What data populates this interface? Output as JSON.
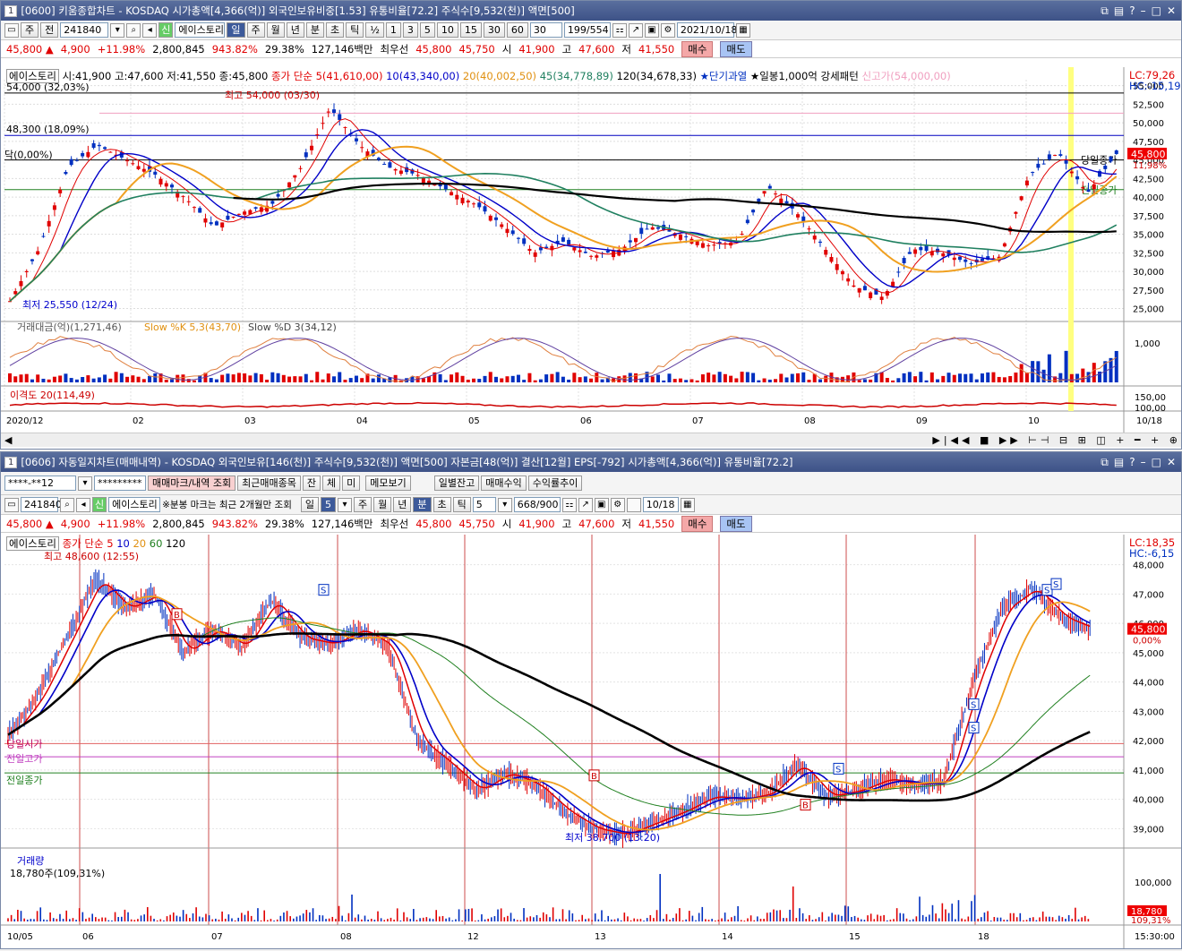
{
  "top": {
    "title": "[0600] 키움종합차트 - KOSDAQ 시가총액[4,366(억)] 외국인보유비중[1.53] 유통비율[72.2] 주식수[9,532(천)] 액면[500]",
    "window_num": "1",
    "toolbar": {
      "period": "주",
      "adj": "전",
      "code": "241840",
      "name": "에이스토리",
      "sel_badge": "신",
      "tabs": [
        "일",
        "주",
        "월",
        "년",
        "분",
        "초",
        "틱"
      ],
      "frac": "½",
      "nums": [
        "1",
        "3",
        "5",
        "10",
        "15",
        "30",
        "60"
      ],
      "n30": "30",
      "count": "199/554",
      "date": "2021/10/18"
    },
    "quote": {
      "price": "45,800 ▲",
      "change": "4,900",
      "pct": "+11.98%",
      "volume": "2,800,845",
      "vol_pct": "943.82%",
      "turnover": "29.38%",
      "amount": "127,146백만",
      "best_label": "최우선",
      "best_ask": "45,800",
      "best_bid": "45,750",
      "open_label": "시",
      "open": "41,900",
      "high_label": "고",
      "high": "47,600",
      "low_label": "저",
      "low": "41,550",
      "buy": "매수",
      "sell": "매도"
    },
    "legend": {
      "name": "에이스토리",
      "ohlc": "시:41,900 고:47,600 저:41,550 종:45,800",
      "ma_label": "종가 단순",
      "ma5": "5(41,610,00)",
      "ma10": "10(43,340,00)",
      "ma20": "20(40,002,50)",
      "ma45": "45(34,778,89)",
      "ma120": "120(34,678,33)",
      "pattern1": "★단기과열",
      "pattern2": "★일봉1,000억 강세패턴",
      "newhigh": "신고가(54,000,00)",
      "lc": "LC:79,26",
      "hc": "HC:-15,19"
    },
    "labels": {
      "level1": "54,000 (32,03%)",
      "level2": "48,300 (18,09%)",
      "level3": "닥(0,00%)",
      "max": "최고 54,000 (03/30)",
      "min": "최저 25,550 (12/24)",
      "today_close": "당일종가",
      "prev_close": "전일종가",
      "last_price": "45,800",
      "last_pct": "11,98%"
    },
    "price_axis": [
      "55,000",
      "52,500",
      "50,000",
      "47,500",
      "45,000",
      "42,500",
      "40,000",
      "37,500",
      "35,000",
      "32,500",
      "30,000",
      "27,500",
      "25,000"
    ],
    "osc": {
      "label1": "거래대금(억)(1,271,46)",
      "label2": "Slow %K 5,3(43,70)",
      "label3": "Slow %D 3(34,12)",
      "axis": "1,000"
    },
    "disp": {
      "label": "이격도 20(114,49)",
      "axis1": "150,00",
      "axis2": "100,00"
    },
    "date_axis": [
      "2020/12",
      "02",
      "03",
      "04",
      "05",
      "06",
      "07",
      "08",
      "09",
      "10"
    ],
    "date_right": "10/18"
  },
  "bottom": {
    "title": "[0606] 자동일지차트(매매내역) - KOSDAQ 외국인보유[146(천)] 주식수[9,532(천)] 액면[500] 자본금[48(억)] 결산[12월] EPS[-792] 시가총액[4,366(억)] 유통비율[72.2]",
    "window_num": "1",
    "toolbar1": {
      "account": "****-**12",
      "password": "*********",
      "b1": "매매마크/내역 조회",
      "b2": "최근매매종목",
      "b3": "잔",
      "b4": "체",
      "b5": "미",
      "b6": "메모보기",
      "b7": "일별잔고",
      "b8": "매매수익",
      "b9": "수익률추이"
    },
    "toolbar2": {
      "code": "241840",
      "sel_badge": "신",
      "name": "에이스토리",
      "note": "※분봉 마크는 최근 2개월만 조회",
      "t_day": "일",
      "n5": "5",
      "tabs": [
        "주",
        "월",
        "년",
        "분",
        "초",
        "틱"
      ],
      "n5b": "5",
      "count": "668/900",
      "date": "10/18"
    },
    "quote": {
      "price": "45,800 ▲",
      "change": "4,900",
      "pct": "+11.98%",
      "volume": "2,800,845",
      "vol_pct": "943.82%",
      "turnover": "29.38%",
      "amount": "127,146백만",
      "best_label": "최우선",
      "best_ask": "45,800",
      "best_bid": "45,750",
      "open_label": "시",
      "open": "41,900",
      "high_label": "고",
      "high": "47,600",
      "low_label": "저",
      "low": "41,550",
      "buy": "매수",
      "sell": "매도"
    },
    "legend": {
      "name": "에이스토리",
      "ma_label": "종가 단순",
      "ma5": "5",
      "ma10": "10",
      "ma20": "20",
      "ma60": "60",
      "ma120": "120",
      "lc": "LC:18,35",
      "hc": "HC:-6,15"
    },
    "labels": {
      "max": "최고 48,600 (12:55)",
      "min": "최저 38,700 (13:20)",
      "today_open": "당일시가",
      "prev_high": "전일고가",
      "prev_close": "전일종가",
      "last_price": "45,800",
      "last_pct": "0,00%"
    },
    "price_axis": [
      "48,000",
      "47,000",
      "46,000",
      "45,000",
      "44,000",
      "43,000",
      "42,000",
      "41,000",
      "40,000",
      "39,000"
    ],
    "vol": {
      "label": "거래량",
      "value": "18,780주(109,31%)",
      "axis": "100,000",
      "last": "18,780",
      "last_pct": "109,31%"
    },
    "date_axis": [
      "10/05",
      "06",
      "07",
      "08",
      "12",
      "13",
      "14",
      "15",
      "18"
    ],
    "date_right": "15:30:00"
  },
  "colors": {
    "up": "#e00000",
    "down": "#0030c0",
    "ma5": "#0000c8",
    "ma10": "#1414a0",
    "ma20": "#f0a020",
    "ma45": "#208060",
    "ma120": "#000000",
    "today": "#ffff80"
  }
}
